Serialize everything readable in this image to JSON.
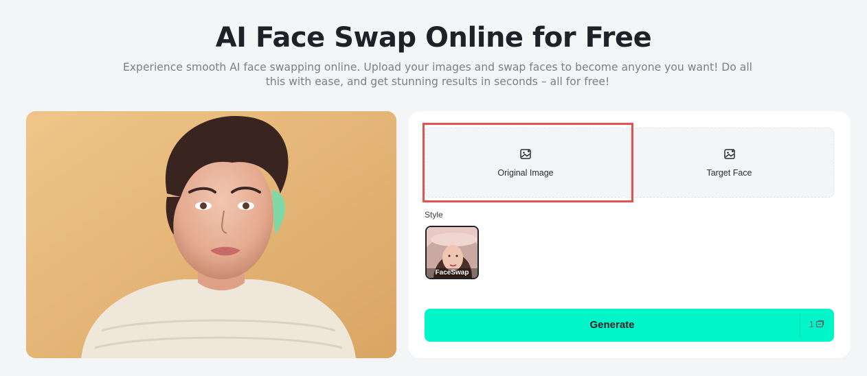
{
  "hero": {
    "title": "AI Face Swap Online for Free",
    "subtitle": "Experience smooth AI face swapping online. Upload your images and swap faces to become anyone you want! Do all this with ease, and get stunning results in seconds – all for free!"
  },
  "panel": {
    "upload_original": {
      "label": "Original Image",
      "icon": "image-upload-icon"
    },
    "upload_target": {
      "label": "Target Face",
      "icon": "image-upload-icon"
    },
    "style_label": "Style",
    "styles": [
      {
        "label": "FaceSwap",
        "selected": true
      }
    ],
    "generate": {
      "label": "Generate",
      "credit": "1",
      "credit_icon": "credit-icon"
    }
  },
  "colors": {
    "accent": "#00f5c8",
    "highlight": "#e55050",
    "background": "#f4f5f7"
  }
}
